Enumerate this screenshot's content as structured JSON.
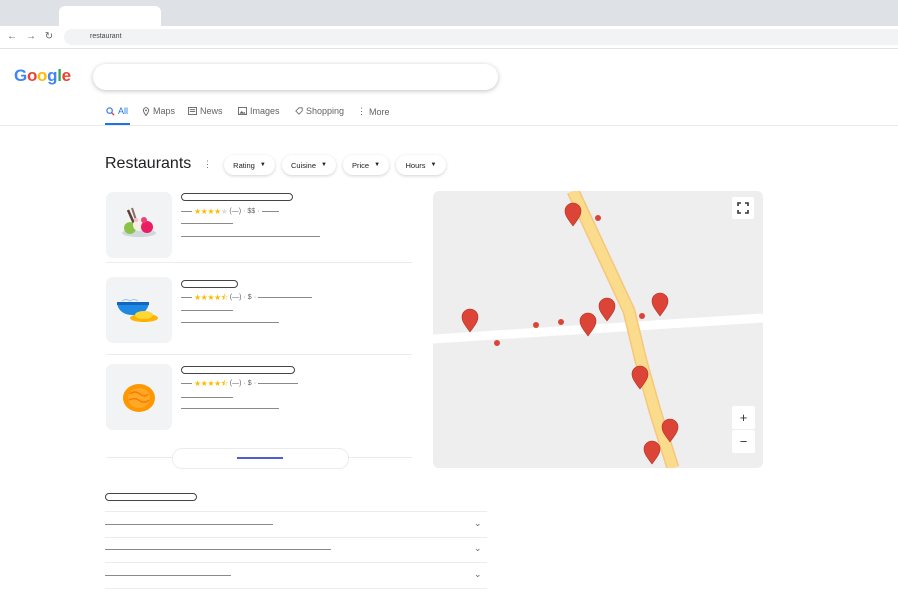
{
  "browser": {
    "url": "restaurant",
    "nav_icons": [
      "back-arrow-icon",
      "forward-arrow-icon",
      "reload-icon"
    ]
  },
  "google": {
    "logo_letters": [
      {
        "ch": "G",
        "color": "#4285f4"
      },
      {
        "ch": "o",
        "color": "#ea4335"
      },
      {
        "ch": "o",
        "color": "#fbbc05"
      },
      {
        "ch": "g",
        "color": "#4285f4"
      },
      {
        "ch": "l",
        "color": "#34a853"
      },
      {
        "ch": "e",
        "color": "#ea4335"
      }
    ],
    "search_query": ""
  },
  "tabs": [
    {
      "label": "All",
      "icon": "search-icon",
      "active": true
    },
    {
      "label": "Maps",
      "icon": "map-pin-icon"
    },
    {
      "label": "News",
      "icon": "newspaper-icon"
    },
    {
      "label": "Images",
      "icon": "image-icon"
    },
    {
      "label": "Shopping",
      "icon": "tag-icon"
    },
    {
      "label": "More",
      "icon": "kebab-icon"
    }
  ],
  "results": {
    "title": "Restaurants",
    "filters": [
      "Rating",
      "Cuisine",
      "Price",
      "Hours"
    ],
    "items": [
      {
        "stars": 4,
        "half": false,
        "reviews": "(—)",
        "price": "$$",
        "food_icon": "ice-cream-icon"
      },
      {
        "stars": 4,
        "half": true,
        "reviews": "(—)",
        "price": "$",
        "food_icon": "noodle-bowl-icon"
      },
      {
        "stars": 4,
        "half": true,
        "reviews": "(—)",
        "price": "$",
        "food_icon": "pasta-icon"
      }
    ]
  },
  "map": {
    "fullscreen_icon": "fullscreen-icon",
    "zoom_in": "+",
    "zoom_out": "−",
    "pin_color": "#db4437",
    "road_color": "#fbdc8d"
  },
  "faq": {
    "count": 3,
    "icon": "chevron-down-icon"
  }
}
